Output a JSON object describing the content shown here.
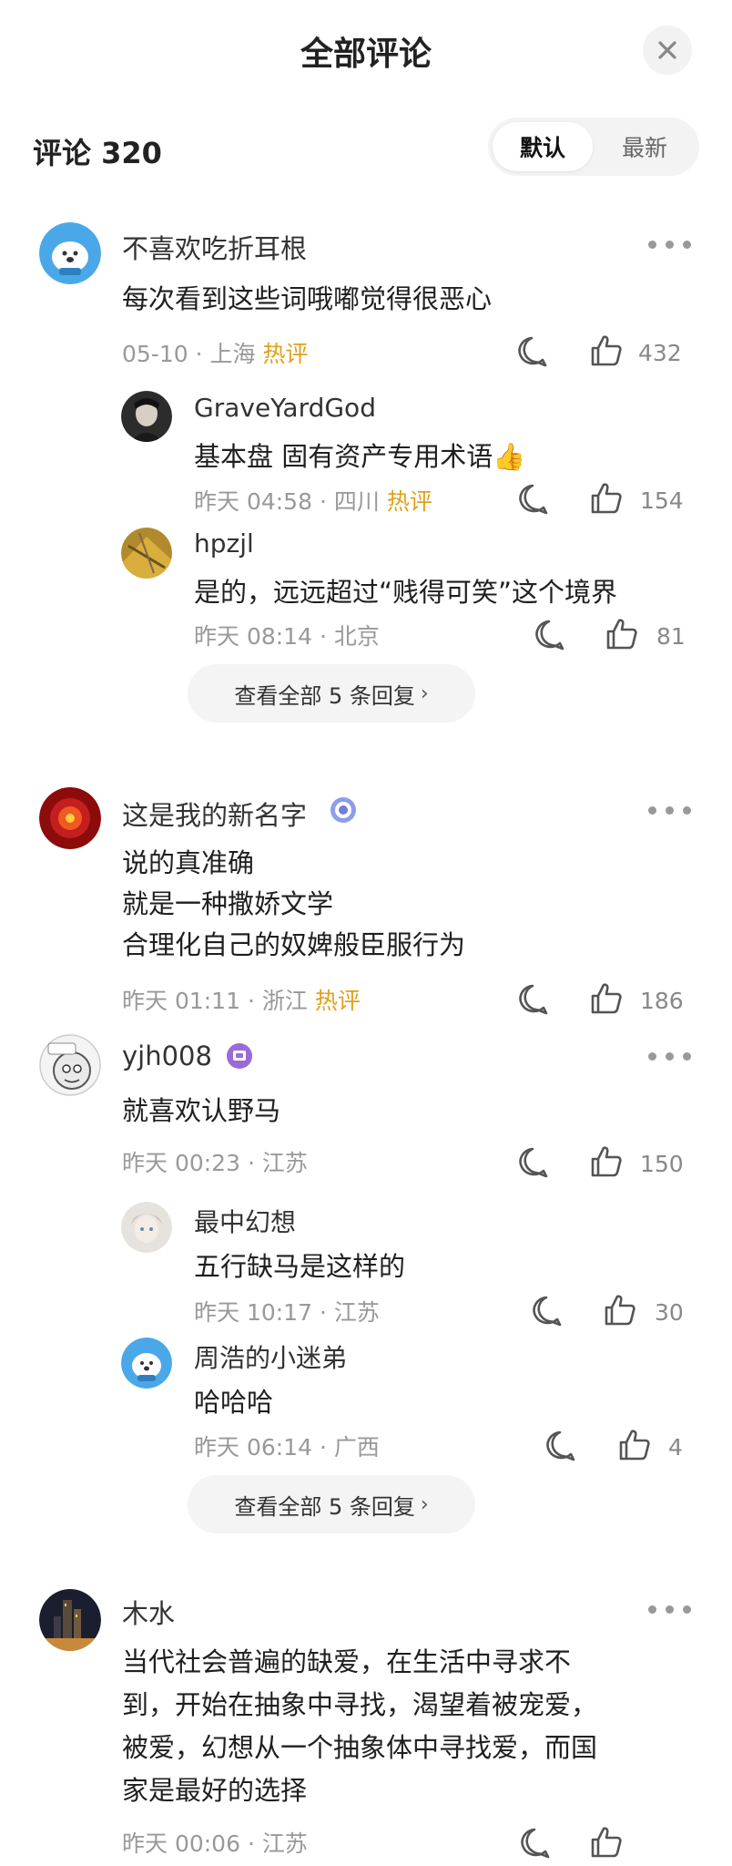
{
  "header": {
    "title": "全部评论"
  },
  "comment_count": "评论 320",
  "sort": {
    "default_label": "默认",
    "latest_label": "最新"
  },
  "comments": [
    {
      "username": "不喜欢吃折耳根",
      "text": "每次看到这些词哦嘟觉得很恶心",
      "date": "05-10",
      "location": "上海",
      "hot": "热评",
      "likes": "432",
      "replies": [
        {
          "username": "GraveYardGod",
          "text": "基本盘 固有资产专用术语👍",
          "date": "昨天 04:58",
          "location": "四川",
          "hot": "热评",
          "likes": "154"
        },
        {
          "username": "hpzjl",
          "text": "是的，远远超过“贱得可笑”这个境界",
          "date": "昨天 08:14",
          "location": "北京",
          "likes": "81"
        }
      ],
      "view_all": "查看全部 5 条回复"
    },
    {
      "username": "这是我的新名字",
      "lines": [
        "说的真准确",
        "就是一种撒娇文学",
        "合理化自己的奴婢般臣服行为"
      ],
      "date": "昨天 01:11",
      "location": "浙江",
      "hot": "热评",
      "likes": "186"
    },
    {
      "username": "yjh008",
      "text": "就喜欢认野马",
      "date": "昨天 00:23",
      "location": "江苏",
      "likes": "150",
      "replies": [
        {
          "username": "最中幻想",
          "text": "五行缺马是这样的",
          "date": "昨天 10:17",
          "location": "江苏",
          "likes": "30"
        },
        {
          "username": "周浩的小迷弟",
          "text": "哈哈哈",
          "date": "昨天 06:14",
          "location": "广西",
          "likes": "4"
        }
      ],
      "view_all": "查看全部 5 条回复"
    },
    {
      "username": "木水",
      "lines": [
        "当代社会普遍的缺爱，在生活中寻求不",
        "到，开始在抽象中寻找，渴望着被宠爱，",
        "被爱，幻想从一个抽象体中寻找爱，而国",
        "家是最好的选择"
      ],
      "date": "昨天 00:06",
      "location": "江苏"
    }
  ]
}
